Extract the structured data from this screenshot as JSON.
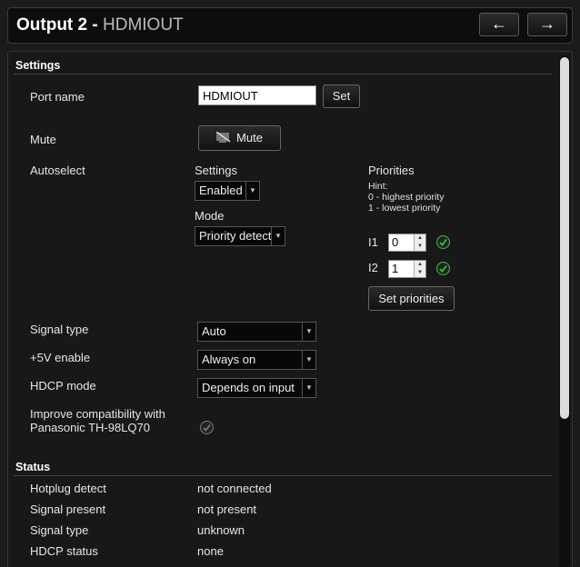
{
  "header": {
    "title_main": "Output 2",
    "title_sep": " - ",
    "title_sub": "HDMIOUT",
    "prev_icon": "arrow-left-icon",
    "next_icon": "arrow-right-icon"
  },
  "settings": {
    "section_title": "Settings",
    "port_name_label": "Port name",
    "port_name_value": "HDMIOUT",
    "set_label": "Set",
    "mute_label": "Mute",
    "mute_button_label": "Mute",
    "mute_icon": "speaker-muted-icon",
    "autoselect_label": "Autoselect",
    "autoselect_settings_label": "Settings",
    "autoselect_settings_value": "Enabled",
    "mode_label": "Mode",
    "mode_value": "Priority detect",
    "priorities_label": "Priorities",
    "hint_title": "Hint:",
    "hint_line1": "0 - highest priority",
    "hint_line2": "1 - lowest priority",
    "priorities": [
      {
        "input": "I1",
        "value": "0",
        "status_icon": "check-circle-icon",
        "status_color": "#3bbf3b"
      },
      {
        "input": "I2",
        "value": "1",
        "status_icon": "check-circle-icon",
        "status_color": "#3bbf3b"
      }
    ],
    "set_priorities_label": "Set priorities",
    "signal_type_label": "Signal type",
    "signal_type_value": "Auto",
    "plus5v_label": "+5V enable",
    "plus5v_value": "Always on",
    "hdcp_mode_label": "HDCP mode",
    "hdcp_mode_value": "Depends on input",
    "compat_label_line1": "Improve compatibility with",
    "compat_label_line2": "Panasonic TH-98LQ70",
    "compat_checked": false
  },
  "status": {
    "section_title": "Status",
    "rows": [
      {
        "label": "Hotplug detect",
        "value": "not connected"
      },
      {
        "label": "Signal present",
        "value": "not present"
      },
      {
        "label": "Signal type",
        "value": "unknown"
      },
      {
        "label": "HDCP status",
        "value": "none"
      }
    ]
  }
}
